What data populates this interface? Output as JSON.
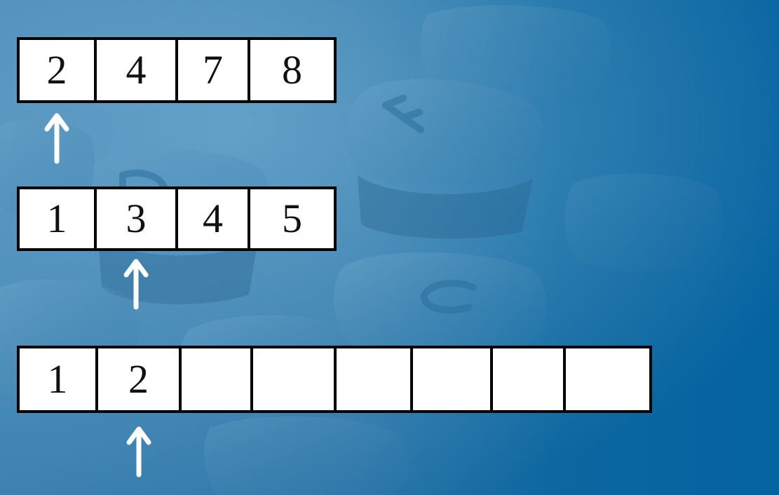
{
  "arrays": [
    {
      "name": "array-a",
      "cells": [
        "2",
        "4",
        "7",
        "8"
      ]
    },
    {
      "name": "array-b",
      "cells": [
        "1",
        "3",
        "4",
        "5"
      ]
    },
    {
      "name": "merged-array",
      "cells": [
        "1",
        "2",
        "",
        "",
        "",
        "",
        "",
        ""
      ]
    }
  ],
  "pointers": [
    {
      "array": "array-a",
      "index": 0,
      "icon": "up-arrow-icon"
    },
    {
      "array": "array-b",
      "index": 1,
      "icon": "up-arrow-icon"
    },
    {
      "array": "merged-array",
      "index": 1,
      "icon": "up-arrow-icon"
    }
  ],
  "colors": {
    "background_left": "#3d82b1",
    "background_right": "#0563a0",
    "cell_fill": "#ffffff",
    "cell_border": "#000000",
    "arrow": "#ffffff"
  }
}
